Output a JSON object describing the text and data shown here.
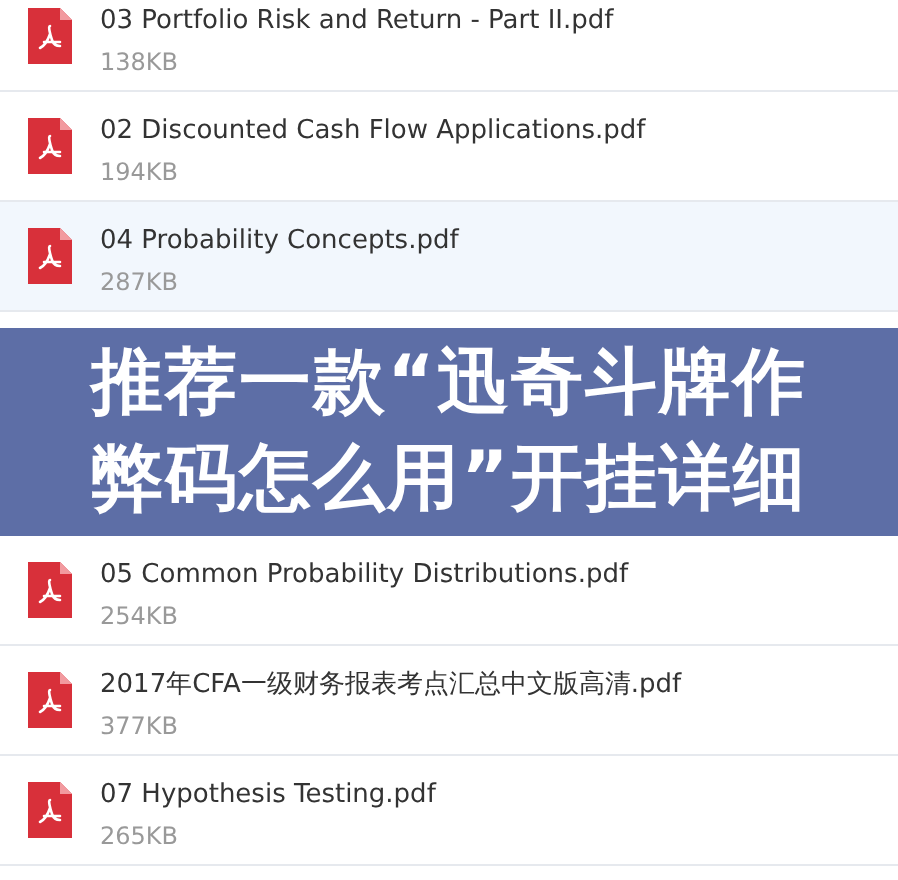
{
  "files": [
    {
      "name": "03 Portfolio Risk and Return - Part II.pdf",
      "size": "138KB",
      "selected": false
    },
    {
      "name": "02 Discounted Cash Flow Applications.pdf",
      "size": "194KB",
      "selected": false
    },
    {
      "name": "04 Probability Concepts.pdf",
      "size": "287KB",
      "selected": true
    }
  ],
  "overlay_banner": {
    "lines": [
      "推荐一款“迅奇斗牌作",
      "弊码怎么用”开挂详细"
    ]
  },
  "more_files": [
    {
      "name": "05 Common Probability Distributions.pdf",
      "size": "254KB",
      "selected": false
    },
    {
      "name": "2017年CFA一级财务报表考点汇总中文版高清.pdf",
      "size": "377KB",
      "selected": false
    },
    {
      "name": "07 Hypothesis Testing.pdf",
      "size": "265KB",
      "selected": false
    }
  ]
}
